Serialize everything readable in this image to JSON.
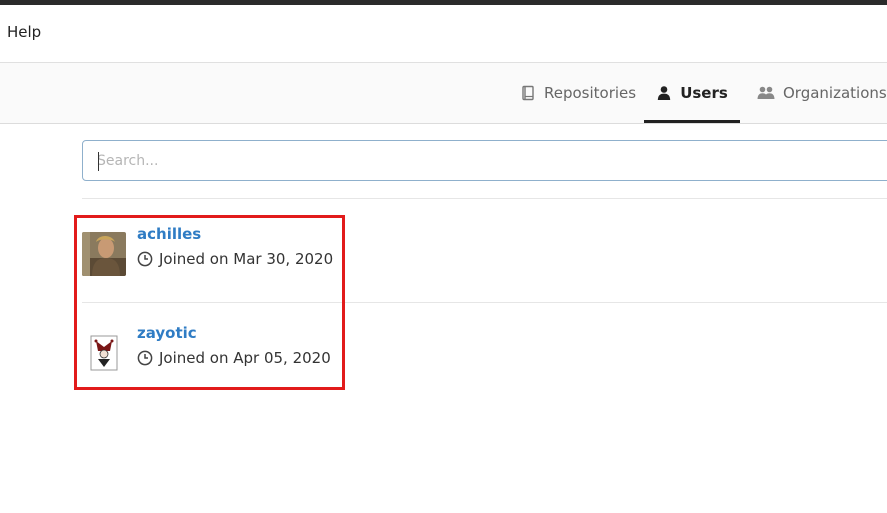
{
  "navbar": {
    "help_label": "Help"
  },
  "tabs": [
    {
      "label": "Repositories",
      "icon": "book-icon",
      "active": false
    },
    {
      "label": "Users",
      "icon": "user-icon",
      "active": true
    },
    {
      "label": "Organizations",
      "icon": "users-group-icon",
      "active": false
    }
  ],
  "search": {
    "placeholder": "Search...",
    "value": ""
  },
  "users": [
    {
      "username": "achilles",
      "joined": "Joined on Mar 30, 2020"
    },
    {
      "username": "zayotic",
      "joined": "Joined on Apr 05, 2020"
    }
  ],
  "colors": {
    "link": "#2f7cc4",
    "highlight": "#e21b1b",
    "search_border": "#8fb0cc"
  }
}
